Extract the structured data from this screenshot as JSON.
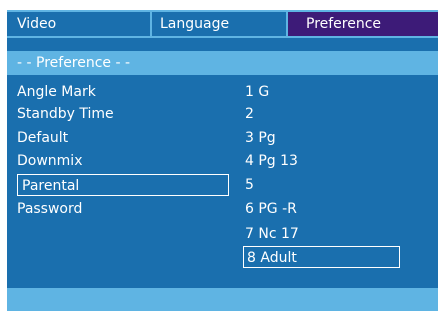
{
  "tabs": {
    "video": "Video",
    "language": "Language",
    "preference": "Preference"
  },
  "section_title": "- - Preference - -",
  "menu": [
    {
      "label": "Angle Mark"
    },
    {
      "label": "Standby Time"
    },
    {
      "label": "Default"
    },
    {
      "label": "Downmix"
    },
    {
      "label": "Parental",
      "selected": true
    },
    {
      "label": "Password"
    }
  ],
  "options": [
    {
      "label": "1  G"
    },
    {
      "label": "2"
    },
    {
      "label": "3  Pg"
    },
    {
      "label": "4  Pg  13"
    },
    {
      "label": "5"
    },
    {
      "label": "6 PG -R"
    },
    {
      "label": "7  Nc  17"
    },
    {
      "label": "8  Adult",
      "selected": true
    }
  ],
  "colors": {
    "background": "#1a6fae",
    "accent": "#5fb4e3",
    "active_tab": "#3d1b78",
    "text": "#ffffff"
  }
}
